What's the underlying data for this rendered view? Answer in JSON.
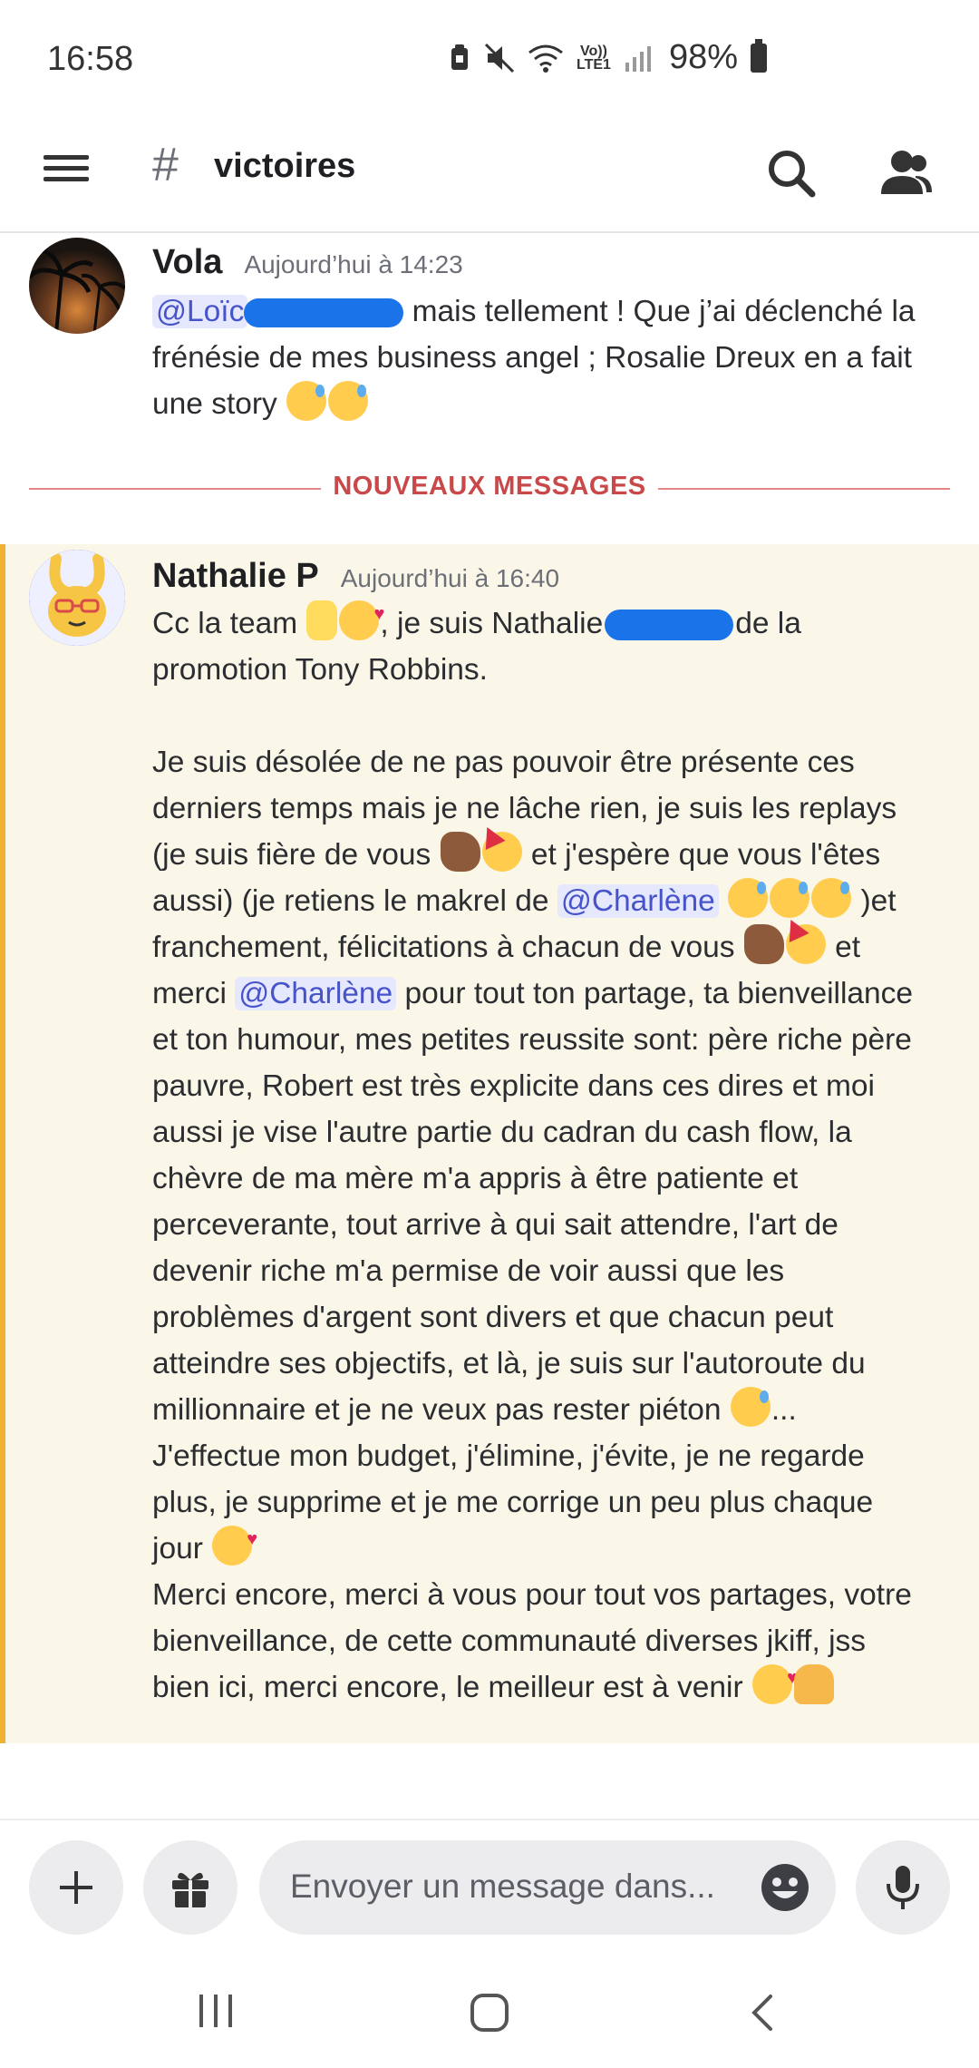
{
  "status_bar": {
    "time": "16:58",
    "network_label": "Vo))\nLTE1",
    "battery": "98%",
    "icons": [
      "vibrate-icon",
      "mute-icon",
      "wifi-icon",
      "signal-icon",
      "battery-icon"
    ]
  },
  "header": {
    "channel_prefix": "#",
    "channel_name": "victoires",
    "icons": [
      "menu-icon",
      "search-icon",
      "members-icon"
    ]
  },
  "messages": [
    {
      "author": "Vola",
      "timestamp": "Aujourd’hui à 14:23",
      "mention": "@Loïc",
      "text_1": " mais tellement ! Que j’ai déclenché la",
      "text_2": "frénésie de mes business angel ; Rosalie Dreux en a fait",
      "text_3": "une story "
    },
    {
      "author": "Nathalie P",
      "timestamp": "Aujourd’hui à 16:40",
      "p1a": "Cc la team ",
      "p1b": ", je suis Nathalie",
      "p1c": "de la",
      "p1d": "promotion Tony Robbins.",
      "p2a": "Je suis désolée de ne pas pouvoir être présente ces",
      "p2b": "derniers temps mais je ne lâche rien, je suis les replays",
      "p2c": "(je suis fière de vous ",
      "p2d": " et j'espère que vous l'êtes",
      "p2e": "aussi) (je retiens le makrel de ",
      "mention_1": "@Charlène",
      "p2f": ")et",
      "p2g": "franchement, félicitations à chacun de vous ",
      "p2h": " et",
      "p2i": "merci ",
      "mention_2": "@Charlène",
      "p2j": " pour tout ton partage, ta bienveillance",
      "p2k": "et ton humour, mes petites reussite sont: père riche père\npauvre, Robert est très explicite dans ces dires et moi\naussi je vise l'autre partie du cadran du cash flow, la\nchèvre de ma mère m'a appris à être patiente et\nperceverante, tout arrive à qui sait attendre, l'art de\ndevenir riche m'a permise de voir aussi que les\nproblèmes d'argent sont divers et que chacun peut\natteindre ses objectifs, et là, je suis sur l'autoroute du\nmillionnaire et je ne veux pas rester piéton ",
      "p2l": "...",
      "p3": "J'effectue mon budget, j'élimine, j'évite, je ne regarde\nplus, je supprime et je me corrige un peu plus chaque\njour ",
      "p4": "Merci encore, merci à vous pour tout vos partages, votre\nbienveillance, de cette communauté diverses jkiff, jss\nbien ici, merci encore, le meilleur est à venir "
    }
  ],
  "divider_label": "NOUVEAUX MESSAGES",
  "input": {
    "placeholder": "Envoyer un message dans..."
  },
  "colors": {
    "mention_bg": "#e6e8fd",
    "mention_text": "#4754c9",
    "new_messages_red": "#c9494a",
    "highlight_bg": "#fbf7e8",
    "highlight_border": "#f0b232",
    "redaction": "#1a73e8"
  }
}
